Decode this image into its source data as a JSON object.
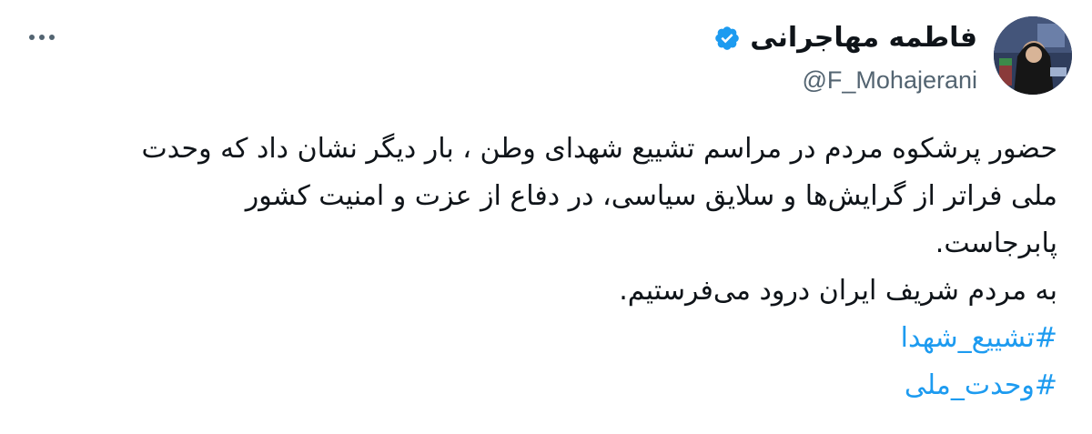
{
  "author": {
    "display_name": "فاطمه مهاجرانی",
    "handle": "@F_Mohajerani",
    "verified": true,
    "avatar_icon": "profile-photo-avatar"
  },
  "header": {
    "more_icon": "more-horizontal-icon"
  },
  "tweet": {
    "paragraphs": [
      "حضور پرشکوه مردم در مراسم تشییع شهدای وطن ، بار دیگر نشان داد که وحدت",
      "ملی فراتر از گرایش‌ها و سلایق سیاسی، در دفاع از عزت و امنیت کشور",
      "پابرجاست.",
      "به مردم شریف ایران درود می‌فرستیم."
    ],
    "hashtags": [
      "#تشییع_شهدا",
      "#وحدت_ملی"
    ]
  },
  "colors": {
    "text": "#0f1419",
    "secondary": "#536471",
    "link": "#1d9bf0",
    "verified_badge": "#1d9bf0"
  }
}
